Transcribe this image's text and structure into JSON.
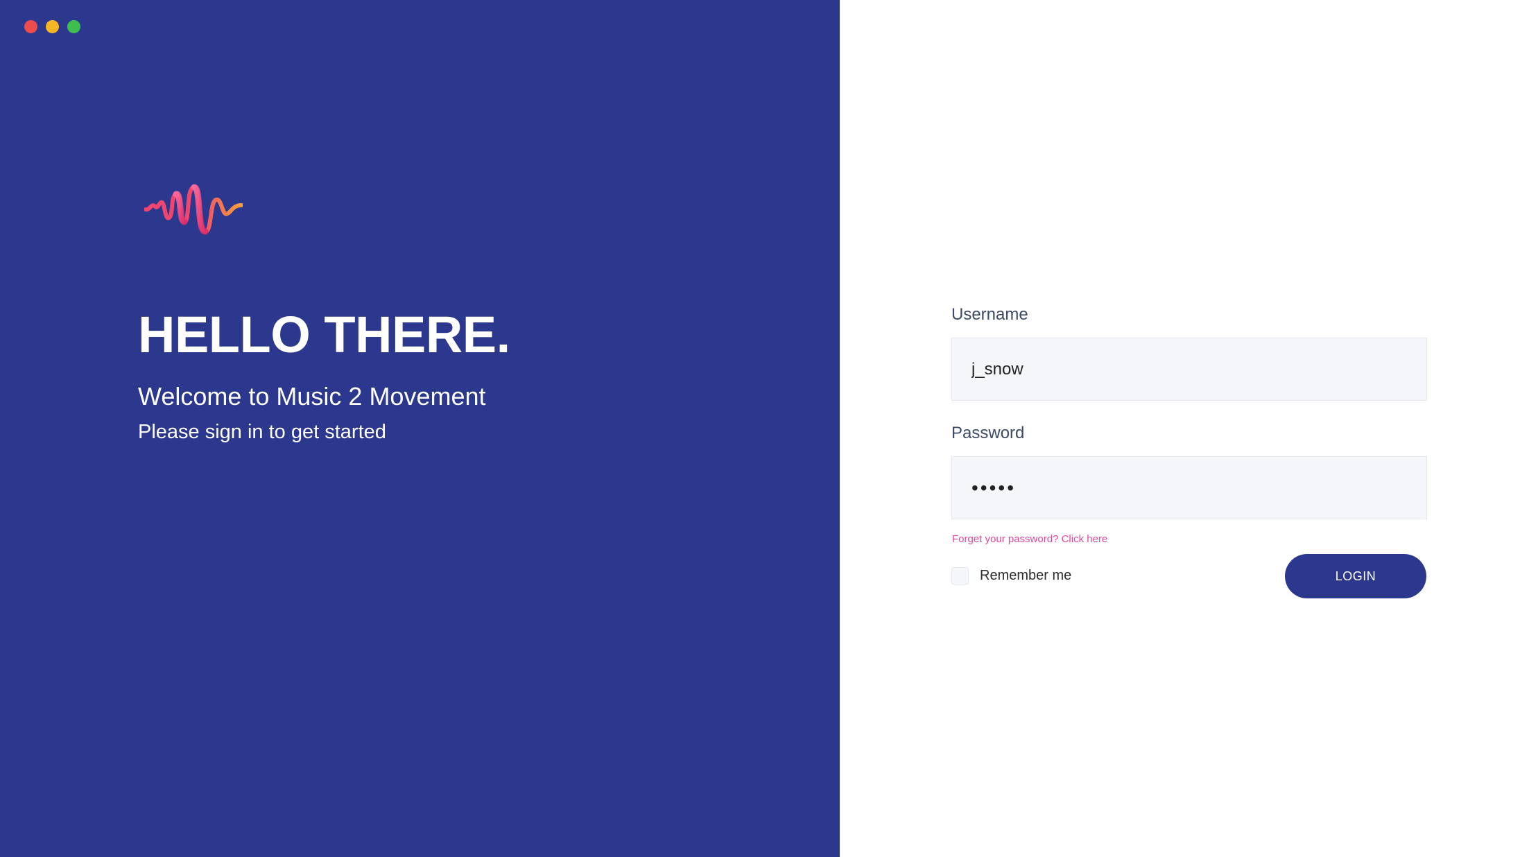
{
  "window": {
    "controls": [
      {
        "name": "close",
        "color": "#ee4c4c"
      },
      {
        "name": "minimize",
        "color": "#f5b625"
      },
      {
        "name": "maximize",
        "color": "#3dbe4f"
      }
    ]
  },
  "colors": {
    "brand": "#2c388e",
    "accent_pink": "#e2479a",
    "logo_gradient_start": "#f0456f",
    "logo_gradient_end": "#f6a13a",
    "input_background": "#f4f6fa"
  },
  "hero": {
    "logo_icon": "sound-wave-logo-icon",
    "title": "HELLO THERE.",
    "welcome": "Welcome to Music 2 Movement",
    "subtitle": "Please sign in to get started"
  },
  "form": {
    "username_label": "Username",
    "username_value": "j_snow",
    "password_label": "Password",
    "password_value": "•••••",
    "forgot_link": "Forget your password? Click here",
    "remember_label": "Remember me",
    "remember_checked": false,
    "login_label": "LOGIN"
  }
}
